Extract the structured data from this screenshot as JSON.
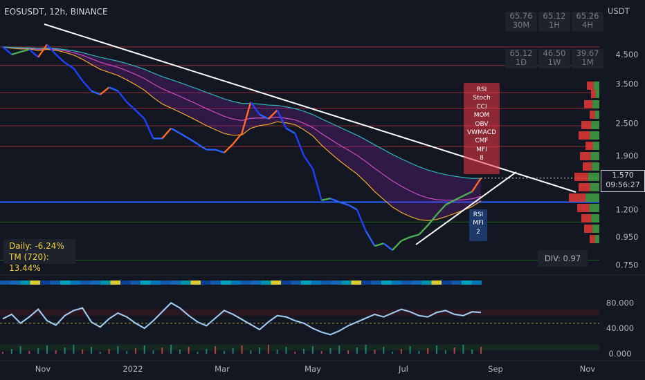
{
  "header": {
    "title": "EOSUSDT, 12h, BINANCE",
    "currency": "USDT"
  },
  "timeframe_table": [
    {
      "value": "65.76",
      "tf": "30M"
    },
    {
      "value": "65.12",
      "tf": "1H"
    },
    {
      "value": "65.26",
      "tf": "4H"
    },
    {
      "value": "65.12",
      "tf": "1D"
    },
    {
      "value": "46.50",
      "tf": "1W"
    },
    {
      "value": "39.67",
      "tf": "1M"
    }
  ],
  "last_price": {
    "price": "1.570",
    "countdown": "09:56:27"
  },
  "stats": {
    "daily": "Daily: -6.24%",
    "tm": "TM (720): 13.44%"
  },
  "divergence": "DIV: 0.97",
  "signals": {
    "top": [
      "RSI",
      "Stoch",
      "CCI",
      "MOM",
      "OBV",
      "VWMACD",
      "CMF",
      "MFI",
      "8"
    ],
    "bottom": [
      "RSI",
      "MFI",
      "2"
    ]
  },
  "colors": {
    "background": "#131722",
    "trendline": "#ffffff",
    "support_line": "#2962ff",
    "resistance_lines": "#b2343f",
    "rsi_line": "#90caf9"
  },
  "chart_data": [
    {
      "type": "line",
      "title": "EOSUSDT, 12h, BINANCE",
      "xlabel": "",
      "ylabel": "USDT",
      "scale": "log",
      "ylim": [
        0.7,
        6.0
      ],
      "x_ticks": [
        "Nov",
        "2022",
        "Mar",
        "May",
        "Jul",
        "Sep",
        "Nov"
      ],
      "y_ticks": [
        "4.500",
        "3.500",
        "2.500",
        "1.900",
        "1.200",
        "0.950",
        "0.750"
      ],
      "price_tags": [
        "1.570"
      ],
      "series": [
        {
          "values": [
            4.8,
            4.5,
            4.6,
            4.7,
            4.4,
            4.9,
            4.5,
            4.2,
            4.0,
            3.6,
            3.3,
            3.2,
            3.4,
            3.3,
            3.0,
            2.8,
            2.6,
            2.2,
            2.2,
            2.4,
            2.3,
            2.2,
            2.1,
            2.0,
            2.0,
            1.95,
            2.1,
            2.3,
            3.0,
            2.7,
            2.6,
            2.8,
            2.4,
            2.3,
            1.9,
            1.7,
            1.3,
            1.32,
            1.28,
            1.25,
            1.2,
            1.0,
            0.88,
            0.9,
            0.85,
            0.92,
            0.95,
            0.97,
            1.05,
            1.15,
            1.25,
            1.3,
            1.35,
            1.4,
            1.57
          ]
        }
      ],
      "grid": false,
      "legend": "none"
    },
    {
      "type": "line",
      "title": "",
      "xlabel": "",
      "ylabel": "",
      "ylim": [
        0,
        100
      ],
      "y_ticks": [
        "80.000",
        "40.000",
        "0.000"
      ],
      "series": [
        {
          "values": [
            55,
            62,
            48,
            58,
            70,
            52,
            45,
            60,
            68,
            72,
            50,
            42,
            55,
            64,
            58,
            48,
            40,
            52,
            66,
            80,
            72,
            60,
            50,
            44,
            56,
            68,
            62,
            54,
            46,
            38,
            50,
            60,
            58,
            52,
            48,
            40,
            34,
            30,
            36,
            44,
            50,
            56,
            62,
            58,
            64,
            70,
            66,
            60,
            58,
            65,
            68,
            62,
            60,
            66,
            65
          ]
        }
      ],
      "grid": false,
      "legend": "none"
    }
  ]
}
